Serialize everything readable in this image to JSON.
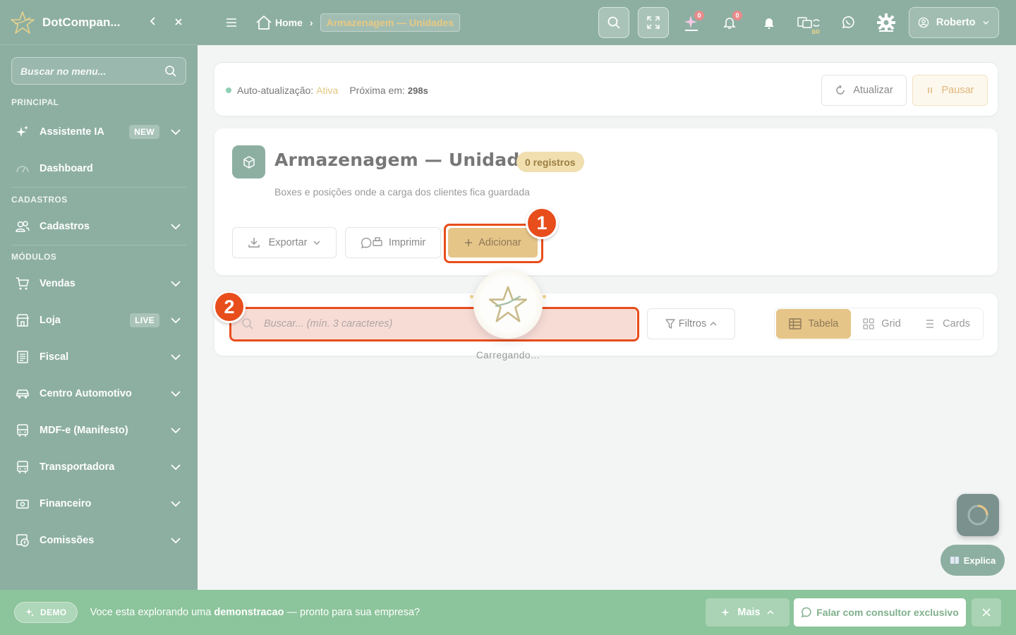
{
  "app": {
    "name": "DotCompan..."
  },
  "sidebar": {
    "search_placeholder": "Buscar no menu...",
    "sections": {
      "principal": "PRINCIPAL",
      "cadastros": "CADASTROS",
      "modulos": "MÓDULOS"
    },
    "items": {
      "assistente": {
        "label": "Assistente IA",
        "badge": "NEW",
        "icon": "sparkles-icon"
      },
      "dashboard": {
        "label": "Dashboard",
        "icon": "gauge-icon"
      },
      "cadastros": {
        "label": "Cadastros",
        "icon": "users-icon"
      },
      "vendas": {
        "label": "Vendas",
        "icon": "cart-icon"
      },
      "loja": {
        "label": "Loja",
        "badge": "LIVE",
        "icon": "store-icon"
      },
      "fiscal": {
        "label": "Fiscal",
        "icon": "receipt-icon"
      },
      "centro": {
        "label": "Centro Automotivo",
        "icon": "car-icon"
      },
      "mdfe": {
        "label": "MDF-e (Manifesto)",
        "icon": "bus-icon"
      },
      "transportadora": {
        "label": "Transportadora",
        "icon": "truck-icon"
      },
      "financeiro": {
        "label": "Financeiro",
        "icon": "money-icon"
      },
      "comissoes": {
        "label": "Comissões",
        "icon": "commission-icon"
      }
    }
  },
  "topbar": {
    "breadcrumb": {
      "home": "Home",
      "current": "Armazenagem — Unidades"
    },
    "ai_count": "0",
    "notif_count": "0",
    "lang_label": "BR",
    "user_name": "Roberto"
  },
  "status": {
    "auto_label": "Auto-atualização:",
    "auto_value": "Ativa",
    "next_label": "Próxima em:",
    "next_value": "298s",
    "refresh_label": "Atualizar",
    "pause_label": "Pausar"
  },
  "page": {
    "title": "Armazenagem — Unidades",
    "records_badge": "0 registros",
    "subtitle": "Boxes e posições onde a carga dos clientes fica guardada",
    "export_label": "Exportar",
    "print_label": "Imprimir",
    "add_label": "Adicionar"
  },
  "filters": {
    "search_placeholder": "Buscar... (mín. 3 caracteres)",
    "filters_label": "Filtros",
    "views": {
      "table": "Tabela",
      "grid": "Grid",
      "cards": "Cards"
    }
  },
  "tutorial": {
    "step1": "1",
    "step2": "2"
  },
  "loading_text": "Carregando...",
  "explica_label": "Explica",
  "demo": {
    "pill": "DEMO",
    "message_pre": "Voce esta explorando uma ",
    "message_bold": "demonstracao",
    "message_post": " — pronto para sua empresa?",
    "more_label": "Mais",
    "cta_label": "Falar com consultor exclusivo"
  },
  "colors": {
    "primary": "#8dafa2",
    "accent": "#e6c589",
    "highlight": "#e84d1c",
    "demo_bar": "#8cc49b"
  }
}
